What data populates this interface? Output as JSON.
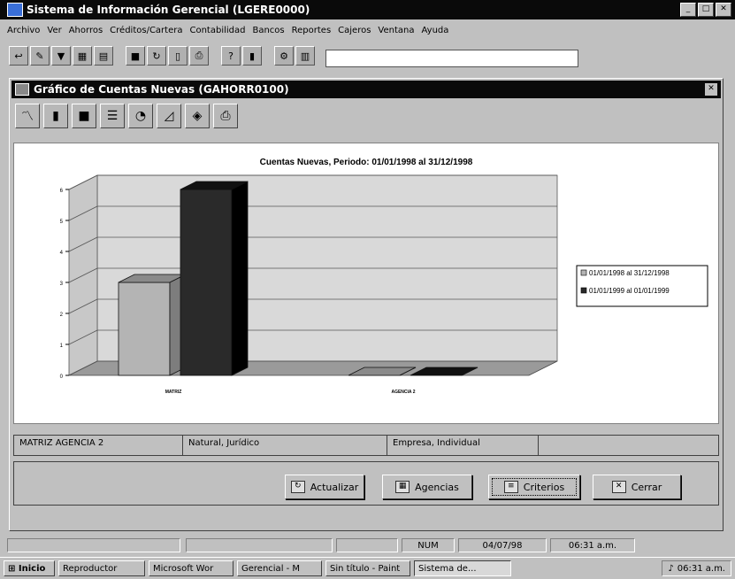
{
  "app": {
    "title": "Sistema de Información Gerencial (LGERE0000)",
    "window_buttons": [
      "_",
      "□",
      "✕"
    ]
  },
  "menu": [
    "Archivo",
    "Ver",
    "Ahorros",
    "Créditos/Cartera",
    "Contabilidad",
    "Bancos",
    "Reportes",
    "Cajeros",
    "Ventana",
    "Ayuda"
  ],
  "toolbar": {
    "icons": [
      "exit-icon",
      "edit-icon",
      "filter-icon",
      "grid-icon",
      "calc-icon",
      "save-icon",
      "refresh-icon",
      "preview-icon",
      "print-icon",
      "help-icon",
      "book-icon",
      "tools-icon",
      "report-icon"
    ],
    "input_value": ""
  },
  "child_window": {
    "title": "Gráfico de Cuentas Nuevas (GAHORR0100)",
    "close": "✕",
    "chart_tools": [
      "line-chart-icon",
      "bar-chart-icon",
      "block-chart-icon",
      "stacked-chart-icon",
      "pie-chart-icon",
      "area-chart-icon",
      "3d-chart-icon",
      "print-chart-icon"
    ]
  },
  "chart_data": {
    "type": "bar",
    "title": "Cuentas Nuevas, Periodo: 01/01/1998 al 31/12/1998",
    "categories": [
      "MATRIZ",
      "AGENCIA 2"
    ],
    "series": [
      {
        "name": "01/01/1998 al 31/12/1998",
        "values": [
          3,
          0
        ],
        "color": "#b4b4b4"
      },
      {
        "name": "01/01/1999 al 01/01/1999",
        "values": [
          6,
          0
        ],
        "color": "#2a2a2a"
      }
    ],
    "yticks": [
      "0",
      "1",
      "2",
      "3",
      "4",
      "5",
      "6"
    ],
    "ylim": [
      0,
      6
    ],
    "grid": true,
    "legend_position": "right",
    "xlabel": "",
    "ylabel": ""
  },
  "status_fields": [
    "MATRIZ AGENCIA 2",
    "Natural, Jurídico",
    "Empresa, Individual",
    ""
  ],
  "buttons": {
    "actualizar": "Actualizar",
    "agencias": "Agencias",
    "criterios": "Criterios",
    "cerrar": "Cerrar"
  },
  "app_status": [
    "",
    "",
    "NUM",
    "04/07/98",
    "06:31 a.m."
  ],
  "taskbar": {
    "start": "Inicio",
    "items": [
      "Reproductor",
      "Microsoft Wor",
      "Gerencial - M",
      "Sin título - Paint",
      "Sistema de..."
    ],
    "active_index": 4,
    "clock": "06:31 a.m."
  }
}
